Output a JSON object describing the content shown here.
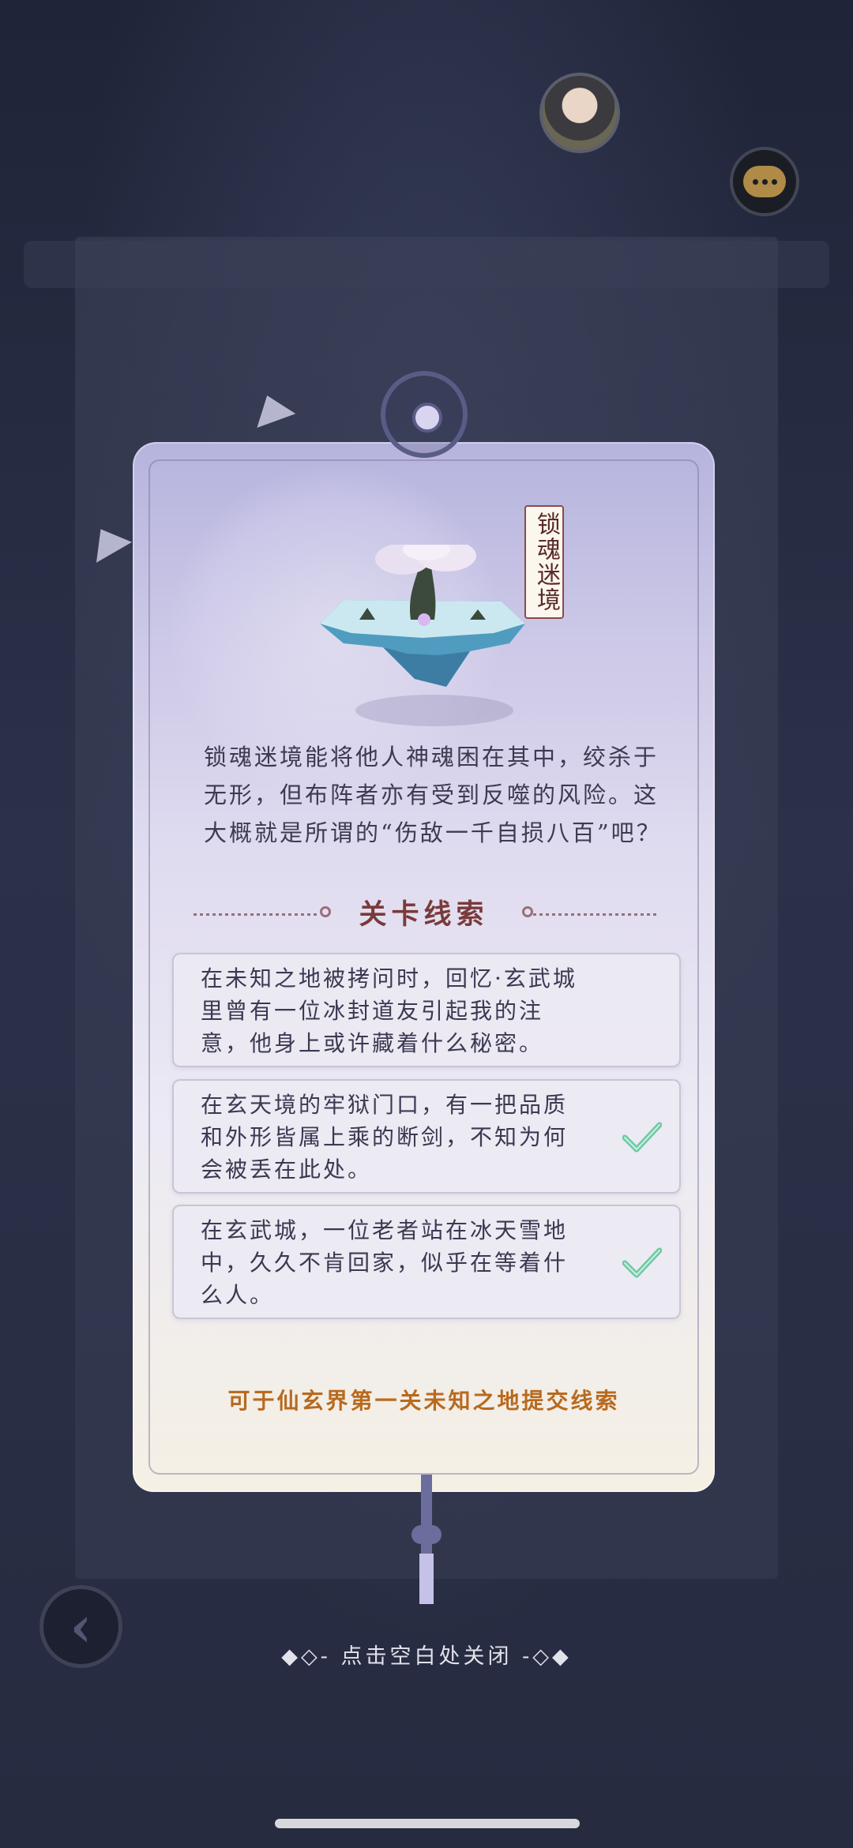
{
  "location_name": "锁魂迷境",
  "description": "锁魂迷境能将他人神魂困在其中，绞杀于无形，但布阵者亦有受到反噬的风险。这大概就是所谓的“伤敌一千自损八百”吧？",
  "section_title": "关卡线索",
  "clues": [
    {
      "text": "在未知之地被拷问时，回忆·玄武城里曾有一位冰封道友引起我的注意，他身上或许藏着什么秘密。",
      "completed": false
    },
    {
      "text": "在玄天境的牢狱门口，有一把品质和外形皆属上乘的断剑，不知为何会被丢在此处。",
      "completed": true
    },
    {
      "text": "在玄武城，一位老者站在冰天雪地中，久久不肯回家，似乎在等着什么人。",
      "completed": true
    }
  ],
  "submit_hint": "可于仙玄界第一关未知之地提交线索",
  "close_hint": "◆◇- 点击空白处关闭 -◇◆",
  "icons": {
    "chat": "chat-bubble-icon",
    "back": "back-arrow-icon",
    "check": "checkmark-icon"
  },
  "colors": {
    "accent_title": "#7a3a3a",
    "submit_hint": "#b86a1e",
    "check": "#6fc9a4"
  }
}
